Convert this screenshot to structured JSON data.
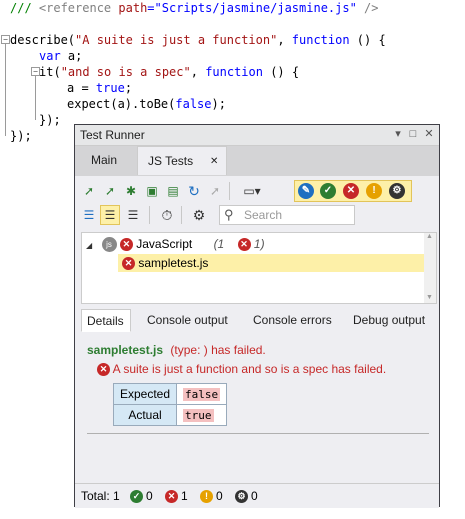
{
  "editor": {
    "line1": {
      "comment": "/// ",
      "tag_open": "<reference ",
      "attr": "path",
      "eq": "=",
      "value": "\"Scripts/jasmine/jasmine.js\"",
      "tag_close": " />"
    },
    "line2": {
      "fn": "describe(",
      "str": "\"A suite is just a function\"",
      "rest1": ", ",
      "kw": "function",
      "rest2": " () {"
    },
    "line3": {
      "kw": "var",
      "rest": " a;"
    },
    "line4": {
      "fn": "it(",
      "str": "\"and so is a spec\"",
      "rest1": ", ",
      "kw": "function",
      "rest2": " () {"
    },
    "line5": {
      "pre": "a = ",
      "kw": "true",
      "post": ";"
    },
    "line6": {
      "pre": "expect(a).toBe(",
      "kw": "false",
      "post": ");"
    },
    "line7": {
      "text": "});"
    },
    "line8": {
      "text": "});"
    }
  },
  "runner": {
    "title": "Test Runner",
    "title_buttons": {
      "dropdown": "▾",
      "maximize": "□",
      "close": "✕"
    },
    "tabs": [
      {
        "label": "Main"
      },
      {
        "label": "JS Tests",
        "close": "✕"
      }
    ],
    "search_placeholder": "Search",
    "tree": {
      "root_label": "JavaScript",
      "root_badge": "js",
      "root_counts": {
        "total": "(1",
        "failed": "1)"
      },
      "child_label": "sampletest.js",
      "expand": "◢"
    },
    "details_tabs": [
      "Details",
      "Console output",
      "Console errors",
      "Debug output"
    ],
    "details": {
      "file": "sampletest.js",
      "status": "(type: ) has failed.",
      "message": "A suite is just a function and so is a spec has failed.",
      "rows": [
        {
          "key": "Expected",
          "value": "false"
        },
        {
          "key": "Actual",
          "value": "true"
        }
      ]
    },
    "status": {
      "total_label": "Total:",
      "total": "1",
      "passed": "0",
      "failed": "1",
      "warnings": "0",
      "other": "0"
    },
    "colors": {
      "fail": "#c62828",
      "pass": "#2e7d32",
      "warn": "#e6a100",
      "other": "#333333",
      "highlight": "#fdf0a8"
    }
  }
}
